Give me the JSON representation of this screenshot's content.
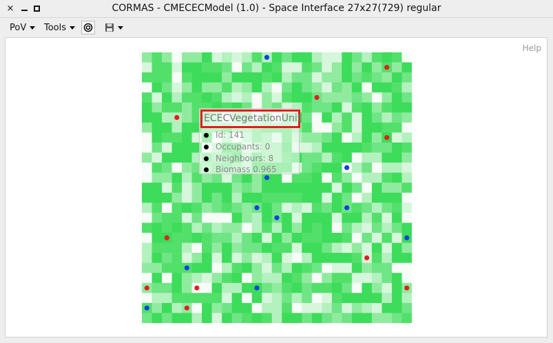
{
  "window": {
    "title": "CORMAS - CMECECModel (1.0) - Space Interface  27x27(729) regular",
    "close_glyph": "×"
  },
  "toolbar": {
    "pov_label": "PoV",
    "tools_label": "Tools"
  },
  "panel": {
    "help_label": "Help"
  },
  "tooltip": {
    "title": "ECECVegetationUnit",
    "id": "Id: 141",
    "occupants": "Occupants: 0",
    "neighbours": "Neighbours: 8",
    "biomass": "Biomass 0.965"
  },
  "grid": {
    "cols": 27,
    "rows": 27,
    "seed": 12345,
    "shades": [
      "#3ddc5a",
      "#52e06a",
      "#6fe585",
      "#90eb9f",
      "#b3f1be",
      "#d6f7dc",
      "#f6fdf7"
    ],
    "agents": {
      "red": "#e0201f",
      "blue": "#1440e0"
    },
    "red_agents": [
      [
        24,
        1
      ],
      [
        17,
        4
      ],
      [
        3,
        6
      ],
      [
        24,
        8
      ],
      [
        2,
        18
      ],
      [
        22,
        20
      ],
      [
        0,
        23
      ],
      [
        5,
        23
      ],
      [
        26,
        23
      ],
      [
        4,
        25
      ]
    ],
    "blue_agents": [
      [
        12,
        0
      ],
      [
        20,
        11
      ],
      [
        12,
        12
      ],
      [
        11,
        15
      ],
      [
        20,
        15
      ],
      [
        13,
        16
      ],
      [
        26,
        18
      ],
      [
        4,
        21
      ],
      [
        11,
        23
      ],
      [
        0,
        25
      ]
    ]
  }
}
